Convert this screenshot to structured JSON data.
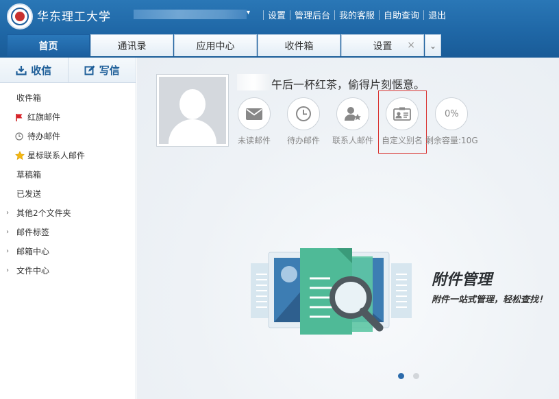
{
  "header": {
    "brand": "华东理工大学",
    "links": [
      "设置",
      "管理后台",
      "我的客服",
      "自助查询",
      "退出"
    ]
  },
  "tabs": [
    {
      "label": "首页",
      "active": true
    },
    {
      "label": "通讯录"
    },
    {
      "label": "应用中心"
    },
    {
      "label": "收件箱"
    },
    {
      "label": "设置",
      "closable": true
    }
  ],
  "compose": {
    "receive": "收信",
    "write": "写信"
  },
  "folders": {
    "inbox": "收件箱",
    "flagged": "红旗邮件",
    "todo": "待办邮件",
    "starred": "星标联系人邮件",
    "drafts": "草稿箱",
    "sent": "已发送",
    "other": "其他2个文件夹",
    "tags": "邮件标签",
    "center": "邮箱中心",
    "files": "文件中心"
  },
  "main": {
    "greeting": "午后一杯红茶，偷得片刻惬意。",
    "quick": {
      "unread": "未读邮件",
      "todo": "待办邮件",
      "contacts": "联系人邮件",
      "alias": "自定义别名",
      "storage_pct": "0%",
      "storage": "剩余容量:10G"
    },
    "banner": {
      "title": "附件管理",
      "subtitle": "附件一站式管理，轻松查找！"
    }
  },
  "colors": {
    "header": "#1f67a6",
    "accent": "#2c6bab",
    "highlight": "#d9322f"
  }
}
